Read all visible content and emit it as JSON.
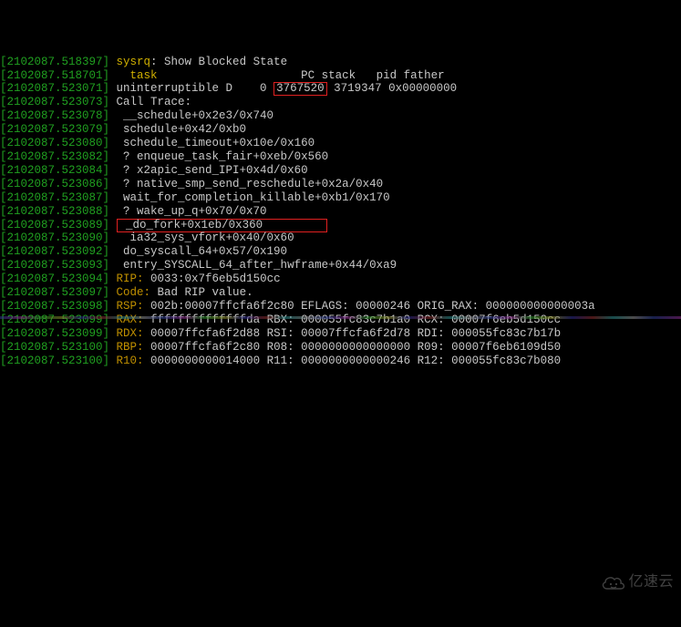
{
  "watermark_text": "亿速云",
  "lines": [
    {
      "ts": "[2102087.518397]",
      "parts": [
        {
          "cls": "hdr",
          "t": " sysrq"
        },
        {
          "cls": "sysrq",
          "t": ": Show Blocked State      "
        },
        {
          "cls": "faded",
          "t": ""
        }
      ]
    },
    {
      "ts": "[2102087.518701]",
      "parts": [
        {
          "cls": "hdr",
          "t": "   task    "
        },
        {
          "cls": "txt",
          "t": "                 PC stack   pid father"
        }
      ]
    },
    {
      "ts": "[2102087.523071]",
      "parts": [
        {
          "cls": "txt",
          "t": " uninterruptible D    0 "
        },
        {
          "cls": "txt redbox",
          "t": "3767520"
        },
        {
          "cls": "txt",
          "t": " 3719347 0x00000000"
        }
      ]
    },
    {
      "ts": "[2102087.523073]",
      "parts": [
        {
          "cls": "txt",
          "t": " Call Trace:"
        }
      ]
    },
    {
      "ts": "[2102087.523078]",
      "parts": [
        {
          "cls": "txt",
          "t": "  __schedule+0x2e3/0x740"
        }
      ]
    },
    {
      "ts": "[2102087.523079]",
      "parts": [
        {
          "cls": "txt",
          "t": "  schedule+0x42/0xb0"
        }
      ]
    },
    {
      "ts": "[2102087.523080]",
      "parts": [
        {
          "cls": "txt",
          "t": "  schedule_timeout+0x10e/0x160"
        }
      ]
    },
    {
      "ts": "[2102087.523082]",
      "parts": [
        {
          "cls": "txt",
          "t": "  ? enqueue_task_fair+0xeb/0x560"
        }
      ]
    },
    {
      "ts": "[2102087.523084]",
      "parts": [
        {
          "cls": "txt",
          "t": "  ? x2apic_send_IPI+0x4d/0x60"
        }
      ]
    },
    {
      "ts": "[2102087.523086]",
      "parts": [
        {
          "cls": "txt",
          "t": "  ? native_smp_send_reschedule+0x2a/0x40"
        }
      ]
    },
    {
      "ts": "[2102087.523087]",
      "parts": [
        {
          "cls": "txt",
          "t": "  wait_for_completion_killable+0xb1/0x170"
        }
      ]
    },
    {
      "ts": "[2102087.523088]",
      "parts": [
        {
          "cls": "txt",
          "t": "  ? wake_up_q+0x70/0x70"
        }
      ]
    },
    {
      "ts": "[2102087.523089]",
      "parts": [
        {
          "cls": "txt",
          "t": " "
        },
        {
          "cls": "txt redbox",
          "t": " _do_fork+0x1eb/0x360         "
        }
      ]
    },
    {
      "ts": "[2102087.523090]",
      "parts": [
        {
          "cls": "txt",
          "t": "   ia32_sys_vfork+0x40/0x60"
        }
      ]
    },
    {
      "ts": "[2102087.523092]",
      "parts": [
        {
          "cls": "txt",
          "t": "  do_syscall_64+0x57/0x190"
        }
      ]
    },
    {
      "ts": "[2102087.523093]",
      "parts": [
        {
          "cls": "txt",
          "t": "  entry_SYSCALL_64_after_hwframe+0x44/0xa9"
        }
      ]
    },
    {
      "ts": "[2102087.523094]",
      "parts": [
        {
          "cls": "reg",
          "t": " RIP:"
        },
        {
          "cls": "txt",
          "t": " 0033:0x7f6eb5d150cc"
        }
      ]
    },
    {
      "ts": "[2102087.523097]",
      "parts": [
        {
          "cls": "reg",
          "t": " Code:"
        },
        {
          "cls": "txt",
          "t": " Bad RIP value."
        }
      ]
    },
    {
      "ts": "[2102087.523098]",
      "parts": [
        {
          "cls": "reg",
          "t": " RSP:"
        },
        {
          "cls": "txt",
          "t": " 002b:00007ffcfa6f2c80 EFLAGS: 00000246 ORIG_RAX: 000000000000003a"
        }
      ]
    },
    {
      "ts": "[2102087.523099]",
      "parts": [
        {
          "cls": "reg",
          "t": " RAX:"
        },
        {
          "cls": "txt",
          "t": " ffffffffffffffda RBX: 000055fc83c7b1a0 RCX: 00007f6eb5d150cc"
        }
      ]
    },
    {
      "ts": "[2102087.523099]",
      "parts": [
        {
          "cls": "reg",
          "t": " RDX:"
        },
        {
          "cls": "txt",
          "t": " 00007ffcfa6f2d88 RSI: 00007ffcfa6f2d78 RDI: 000055fc83c7b17b"
        }
      ]
    },
    {
      "ts": "[2102087.523100]",
      "parts": [
        {
          "cls": "reg",
          "t": " RBP:"
        },
        {
          "cls": "txt",
          "t": " 00007ffcfa6f2c80 R08: 0000000000000000 R09: 00007f6eb6109d50"
        }
      ]
    },
    {
      "ts": "[2102087.523100]",
      "parts": [
        {
          "cls": "reg",
          "t": " R10:"
        },
        {
          "cls": "txt",
          "t": " 0000000000014000 R11: 0000000000000246 R12: 000055fc83c7b080"
        }
      ]
    }
  ]
}
